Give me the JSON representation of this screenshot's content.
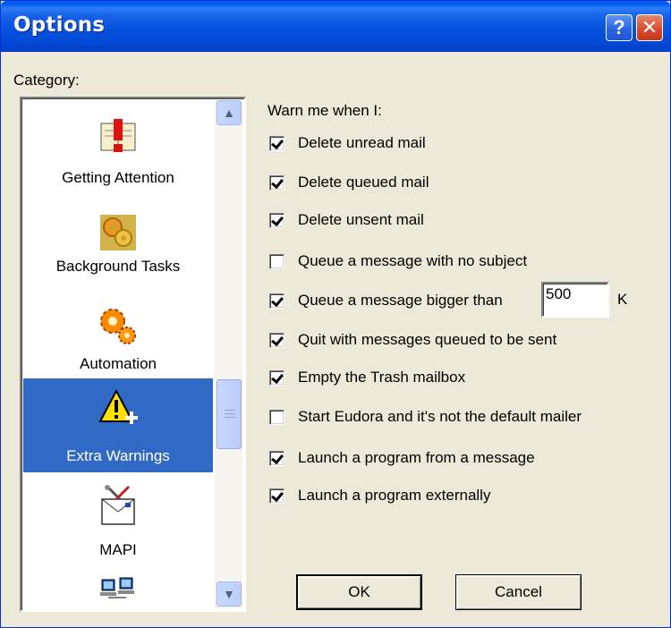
{
  "window": {
    "title": "Options",
    "help_label": "?",
    "close_label": "✕"
  },
  "category": {
    "label": "Category:",
    "items": [
      {
        "label": "Getting Attention",
        "icon": "getting-attention-icon",
        "selected": false
      },
      {
        "label": "Background Tasks",
        "icon": "background-tasks-icon",
        "selected": false
      },
      {
        "label": "Automation",
        "icon": "automation-icon",
        "selected": false
      },
      {
        "label": "Extra Warnings",
        "icon": "extra-warnings-icon",
        "selected": true
      },
      {
        "label": "MAPI",
        "icon": "mapi-icon",
        "selected": false
      },
      {
        "label": "",
        "icon": "network-icon",
        "selected": false
      }
    ],
    "scroll_up": "▲",
    "scroll_down": "▼"
  },
  "warnings": {
    "heading": "Warn me when I:",
    "options": [
      {
        "label": "Delete unread mail",
        "checked": true
      },
      {
        "label": "Delete queued mail",
        "checked": true
      },
      {
        "label": "Delete unsent mail",
        "checked": true
      },
      {
        "label": "Queue a message with no subject",
        "checked": false
      },
      {
        "label": "Queue a message bigger than",
        "checked": true
      },
      {
        "label": "Quit with messages queued to be sent",
        "checked": true
      },
      {
        "label": "Empty the Trash mailbox",
        "checked": true
      },
      {
        "label": "Start Eudora and it's not the default mailer",
        "checked": false
      },
      {
        "label": "Launch a program from a message",
        "checked": true
      },
      {
        "label": "Launch a program externally",
        "checked": true
      }
    ],
    "size_value": "500",
    "size_unit": "K"
  },
  "buttons": {
    "ok": "OK",
    "cancel": "Cancel"
  },
  "colors": {
    "titlebar": "#0058ee",
    "selection": "#316ac5",
    "dialog_bg": "#ece9d8"
  }
}
